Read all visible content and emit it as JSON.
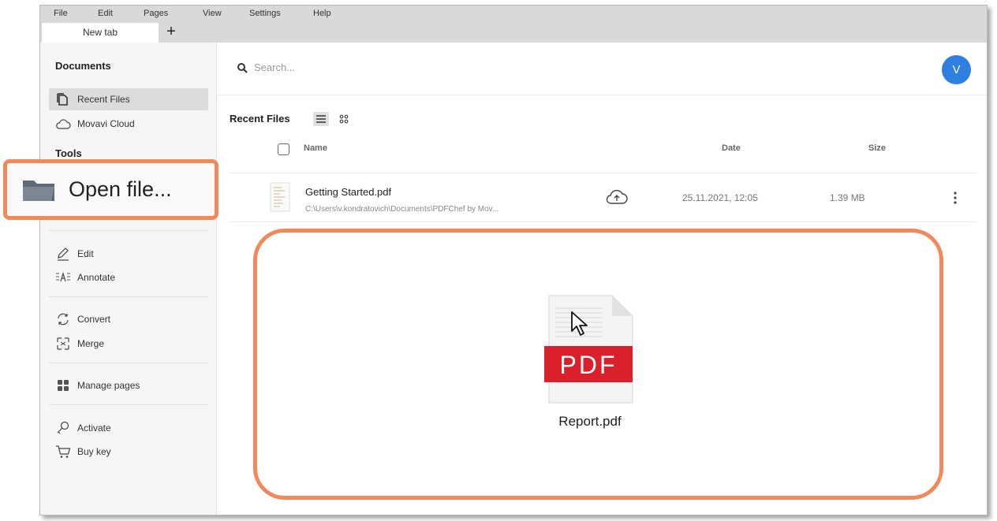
{
  "menu": {
    "items": [
      "File",
      "Edit",
      "Pages",
      "View",
      "Settings",
      "Help"
    ]
  },
  "tabs": {
    "active_label": "New tab",
    "add_label": "+"
  },
  "sidebar": {
    "documents_title": "Documents",
    "recent_files": "Recent Files",
    "movavi_cloud": "Movavi Cloud",
    "tools_title": "Tools",
    "open_file": "Open file...",
    "edit": "Edit",
    "annotate": "Annotate",
    "convert": "Convert",
    "merge": "Merge",
    "manage_pages": "Manage pages",
    "activate": "Activate",
    "buy_key": "Buy key"
  },
  "header": {
    "search_placeholder": "Search...",
    "avatar_initial": "V"
  },
  "recent": {
    "title": "Recent Files",
    "columns": {
      "name": "Name",
      "date": "Date",
      "size": "Size"
    },
    "files": [
      {
        "name": "Getting Started.pdf",
        "path": "C:\\Users\\v.kondratovich\\Documents\\PDFChef by Mov...",
        "date": "25.11.2021, 12:05",
        "size": "1.39 MB"
      }
    ]
  },
  "dropzone": {
    "file_label": "Report.pdf",
    "badge_text": "PDF"
  },
  "colors": {
    "highlight": "#f08a5d",
    "avatar": "#2f7fe0",
    "pdf_red": "#d9202b"
  },
  "icons": [
    "document-icon",
    "cloud-icon",
    "folder-icon",
    "pencil-icon",
    "annotate-icon",
    "convert-icon",
    "merge-icon",
    "grid-icon",
    "key-icon",
    "cart-icon",
    "search-icon",
    "list-view-icon",
    "grid-view-icon",
    "cloud-upload-icon",
    "more-icon",
    "pdf-file-icon",
    "cursor-icon"
  ]
}
